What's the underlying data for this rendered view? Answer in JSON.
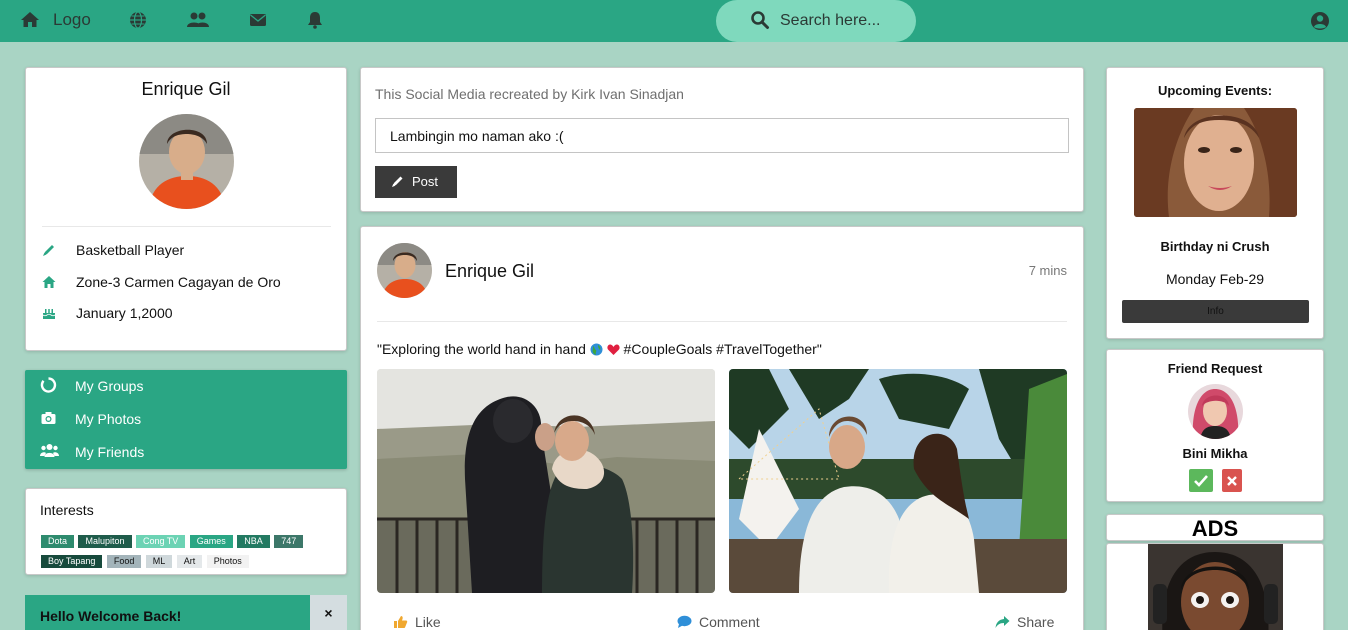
{
  "nav": {
    "logo": "Logo",
    "icons": [
      "home-icon",
      "globe-icon",
      "users-icon",
      "envelope-icon",
      "bell-icon",
      "user-circle-icon"
    ],
    "search_placeholder": "Search here..."
  },
  "profile": {
    "name": "Enrique Gil",
    "info": [
      {
        "icon": "pencil-icon",
        "text": "Basketball Player"
      },
      {
        "icon": "home-icon",
        "text": "Zone-3 Carmen Cagayan de Oro"
      },
      {
        "icon": "birthday-cake-icon",
        "text": "January 1,2000"
      }
    ]
  },
  "menu": {
    "items": [
      {
        "icon": "circle-notch-icon",
        "label": "My Groups"
      },
      {
        "icon": "camera-icon",
        "label": "My Photos"
      },
      {
        "icon": "users-icon",
        "label": "My Friends"
      }
    ]
  },
  "interests": {
    "title": "Interests",
    "tags": [
      {
        "label": "Dota",
        "color": "#2e8b6e"
      },
      {
        "label": "Malupiton",
        "color": "#1f5c4b"
      },
      {
        "label": "Cong TV",
        "color": "#6cd3b4"
      },
      {
        "label": "Games",
        "color": "#2aa684"
      },
      {
        "label": "NBA",
        "color": "#237a62"
      },
      {
        "label": "747",
        "color": "#3c7769"
      },
      {
        "label": "Boy Tapang",
        "color": "#174a3c"
      },
      {
        "label": "Food",
        "color": "#a3b4ba"
      },
      {
        "label": "ML",
        "color": "#cfd8db"
      },
      {
        "label": "Art",
        "color": "#e4e8ea"
      },
      {
        "label": "Photos",
        "color": "#f2f2f2"
      }
    ]
  },
  "welcome": {
    "text": "Hello Welcome Back!",
    "close": "×"
  },
  "composer": {
    "credit": "This Social Media recreated by Kirk Ivan Sinadjan",
    "input_value": "Lambingin mo naman ako :(",
    "post_label": "Post"
  },
  "post": {
    "author": "Enrique Gil",
    "time": "7 mins",
    "caption_before": "\"Exploring the world hand in hand ",
    "caption_after": " #CoupleGoals #TravelTogether\"",
    "actions": {
      "like": "Like",
      "comment": "Comment",
      "share": "Share"
    }
  },
  "events": {
    "title": "Upcoming Events:",
    "name": "Birthday ni Crush",
    "date": "Monday Feb-29",
    "info_label": "Info"
  },
  "friend_request": {
    "title": "Friend Request",
    "name": "Bini Mikha"
  },
  "ads": {
    "title": "ADS"
  },
  "colors": {
    "accent": "#2aa684",
    "background": "#a9d4c4",
    "search_bg": "#7fd9bd",
    "dark_button": "#3a3a3a",
    "accept": "#5cb85c",
    "decline": "#d9534f"
  }
}
